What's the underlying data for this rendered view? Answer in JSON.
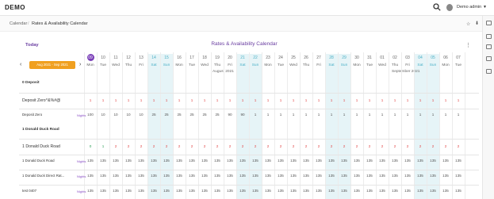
{
  "app": {
    "title": "DEMO",
    "user": "Demo admin"
  },
  "breadcrumb": {
    "home": "Calendar",
    "sep": "/",
    "current": "Rates & Availability Calendar"
  },
  "calendar": {
    "today_label": "Today",
    "title": "Rates & Availability Calendar",
    "date_range": "Aug 2021 - Sep 2021",
    "days": [
      {
        "num": "09",
        "name": "Mon",
        "wknd": false,
        "today": true
      },
      {
        "num": "10",
        "name": "Tue",
        "wknd": false
      },
      {
        "num": "11",
        "name": "Wed",
        "wknd": false
      },
      {
        "num": "12",
        "name": "Thu",
        "wknd": false
      },
      {
        "num": "13",
        "name": "Fri",
        "wknd": false
      },
      {
        "num": "14",
        "name": "Sat",
        "wknd": true
      },
      {
        "num": "15",
        "name": "Sun",
        "wknd": true
      },
      {
        "num": "16",
        "name": "Mon",
        "wknd": false
      },
      {
        "num": "17",
        "name": "Tue",
        "wknd": false
      },
      {
        "num": "18",
        "name": "Wed",
        "wknd": false
      },
      {
        "num": "19",
        "name": "Thu",
        "wknd": false
      },
      {
        "num": "20",
        "name": "Fri",
        "wknd": false
      },
      {
        "num": "21",
        "name": "Sat",
        "wknd": true
      },
      {
        "num": "22",
        "name": "Sun",
        "wknd": true
      },
      {
        "num": "23",
        "name": "Mon",
        "wknd": false
      },
      {
        "num": "24",
        "name": "Tue",
        "wknd": false
      },
      {
        "num": "25",
        "name": "Wed",
        "wknd": false
      },
      {
        "num": "26",
        "name": "Thu",
        "wknd": false
      },
      {
        "num": "27",
        "name": "Fri",
        "wknd": false
      },
      {
        "num": "28",
        "name": "Sat",
        "wknd": true
      },
      {
        "num": "29",
        "name": "Sun",
        "wknd": true
      },
      {
        "num": "30",
        "name": "Mon",
        "wknd": false
      },
      {
        "num": "31",
        "name": "Tue",
        "wknd": false
      },
      {
        "num": "01",
        "name": "Wed",
        "wknd": false
      },
      {
        "num": "02",
        "name": "Thu",
        "wknd": false
      },
      {
        "num": "03",
        "name": "Fri",
        "wknd": false
      },
      {
        "num": "04",
        "name": "Sat",
        "wknd": true
      },
      {
        "num": "05",
        "name": "Sun",
        "wknd": true
      },
      {
        "num": "06",
        "name": "Mon",
        "wknd": false
      },
      {
        "num": "07",
        "name": "Tue",
        "wknd": false
      }
    ],
    "months": [
      "August 2021",
      "September 2021"
    ],
    "sections": [
      {
        "title": "0 Deposit",
        "rows": [
          {
            "label": "Deposit Zero^&%#@",
            "kind": "main",
            "color": "red",
            "values": [
              "1",
              "1",
              "1",
              "1",
              "1",
              "1",
              "1",
              "1",
              "1",
              "1",
              "1",
              "1",
              "1",
              "1",
              "1",
              "1",
              "1",
              "1",
              "1",
              "1",
              "1",
              "1",
              "1",
              "1",
              "1",
              "1",
              "1",
              "1",
              "1",
              "1"
            ]
          },
          {
            "label": "Deposit Zero",
            "kind": "rate",
            "nights": "Nights",
            "values": [
              "100",
              "10",
              "10",
              "10",
              "10",
              "25",
              "25",
              "25",
              "25",
              "25",
              "25",
              "90",
              "90",
              "1",
              "1",
              "1",
              "1",
              "1",
              "1",
              "1",
              "1",
              "1",
              "1",
              "1",
              "1",
              "1",
              "1",
              "1",
              "1",
              "1"
            ]
          }
        ]
      },
      {
        "title": "1 Donald Duck Road",
        "rows": [
          {
            "label": "1 Donald Duck Road",
            "kind": "main",
            "color": "red",
            "values": [
              "0",
              "1",
              "2",
              "2",
              "2",
              "2",
              "2",
              "2",
              "2",
              "2",
              "2",
              "2",
              "2",
              "2",
              "2",
              "2",
              "2",
              "2",
              "2",
              "2",
              "2",
              "2",
              "2",
              "2",
              "2",
              "2",
              "2",
              "2",
              "2",
              "2"
            ]
          },
          {
            "label": "1 Donald Duck Road",
            "kind": "rate",
            "nights": "Nights",
            "values": [
              "135",
              "135",
              "135",
              "135",
              "135",
              "135",
              "135",
              "135",
              "135",
              "135",
              "135",
              "135",
              "135",
              "135",
              "135",
              "135",
              "135",
              "135",
              "135",
              "135",
              "135",
              "135",
              "135",
              "135",
              "135",
              "135",
              "135",
              "135",
              "135",
              "135"
            ]
          },
          {
            "label": "1 Donald Duck Direct Rat...",
            "kind": "rate",
            "nights": "Nights",
            "values": [
              "135",
              "135",
              "135",
              "135",
              "135",
              "135",
              "135",
              "135",
              "135",
              "135",
              "135",
              "135",
              "135",
              "135",
              "135",
              "135",
              "135",
              "135",
              "135",
              "135",
              "135",
              "135",
              "135",
              "135",
              "135",
              "135",
              "135",
              "135",
              "135",
              "135"
            ]
          },
          {
            "label": "test 0407",
            "kind": "rate",
            "nights": "Nights",
            "values": [
              "135",
              "135",
              "135",
              "135",
              "135",
              "135",
              "135",
              "135",
              "135",
              "135",
              "135",
              "135",
              "135",
              "135",
              "135",
              "135",
              "135",
              "135",
              "135",
              "135",
              "135",
              "135",
              "135",
              "135",
              "135",
              "135",
              "135",
              "135",
              "135",
              "135"
            ]
          }
        ]
      }
    ]
  },
  "icons": {
    "search": "search-icon",
    "avatar": "user-avatar",
    "star": "star-icon",
    "pin": "pin-icon",
    "menu": "kebab-menu-icon"
  },
  "colors": {
    "accent": "#6a3ea1",
    "weekend": "#4ab0c6",
    "weekend_bg": "#e6f4f7",
    "range": "#f0a020",
    "red": "#e24a4a",
    "green": "#31a05a"
  }
}
